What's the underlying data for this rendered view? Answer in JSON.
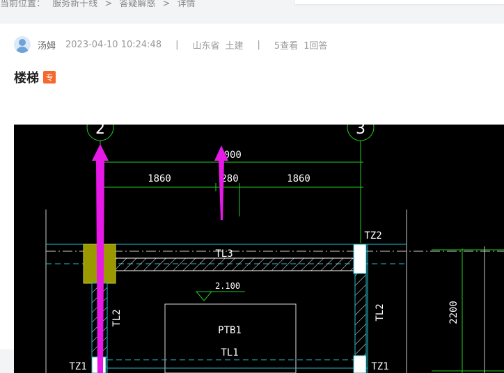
{
  "breadcrumb": {
    "label": "当前位置：",
    "items": [
      "服务新干线",
      "答疑解惑",
      "详情"
    ],
    "separator": ">"
  },
  "post": {
    "author": "汤姆",
    "datetime": "2023-04-10 10:24:48",
    "region": "山东省",
    "category": "土建",
    "views": "5查看",
    "answers": "1回答",
    "title": "楼梯",
    "badge": "专"
  },
  "drawing": {
    "axis_labels": [
      "2",
      "3"
    ],
    "dimensions": [
      "3000",
      "1860",
      "280",
      "1860",
      "2200"
    ],
    "elevation": "2.100",
    "members": {
      "beam_top": "TL3",
      "beam_left": "TL2",
      "beam_right": "TL2",
      "slab": "PTB1",
      "beam_mid": "TL1",
      "col_top_right": "TZ2",
      "col_bottom_left": "TZ1",
      "col_bottom_right": "TZ1"
    }
  },
  "colors": {
    "arrow": "#e619e6",
    "cad_bg": "#000000",
    "badge": "#f5692c"
  }
}
